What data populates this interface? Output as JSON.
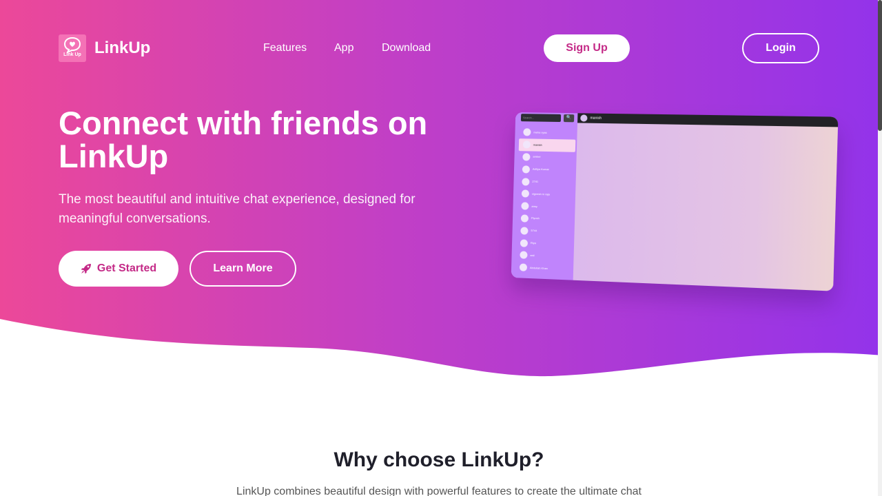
{
  "nav": {
    "logo_text": "Link Up",
    "brand": "LinkUp",
    "links": [
      "Features",
      "App",
      "Download"
    ],
    "signup": "Sign Up",
    "login": "Login"
  },
  "hero": {
    "title": "Connect with friends on LinkUp",
    "subtitle": "The most beautiful and intuitive chat experience, designed for meaningful conversations.",
    "cta_primary": "Get Started",
    "cta_primary_icon": "rocket-icon",
    "cta_secondary": "Learn More"
  },
  "mockup": {
    "search_placeholder": "Search...",
    "search_icon": "🔍",
    "active_chat": "manish",
    "contacts": [
      "meha vyas",
      "manish",
      "amber",
      "Aditya Kumar",
      "2741",
      "vignesh m raja",
      "ansy",
      "Piyush",
      "5744",
      "Riya",
      "anil",
      "Abdullah Khan"
    ],
    "active_index": 1
  },
  "features": {
    "title": "Why choose LinkUp?",
    "intro": "LinkUp combines beautiful design with powerful features to create the ultimate chat"
  },
  "colors": {
    "gradient_start": "#ec4899",
    "gradient_end": "#9333ea",
    "accent": "#c42a87"
  }
}
